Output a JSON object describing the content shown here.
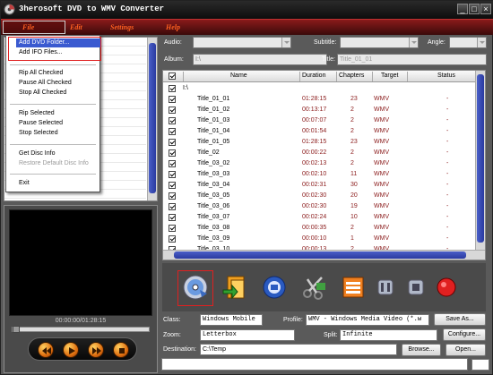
{
  "window": {
    "title": "3herosoft DVD to WMV Converter",
    "controls": [
      "_",
      "□",
      "×"
    ]
  },
  "menubar": {
    "items": [
      "File",
      "Edit",
      "Settings",
      "Help"
    ]
  },
  "file_menu": {
    "group1": [
      "Add DVD Folder...",
      "Add IFO Files..."
    ],
    "group2": [
      "Rip All Checked",
      "Pause All Checked",
      "Stop All Checked"
    ],
    "group3": [
      "Rip Selected",
      "Pause Selected",
      "Stop Selected"
    ],
    "group4": [
      "Get Disc Info",
      "Restore Default Disc Info"
    ],
    "group5": [
      "Exit"
    ]
  },
  "top_controls": {
    "audio_label": "Audio:",
    "subtitle_label": "Subtitle:",
    "angle_label": "Angle:",
    "album_label": "Album:",
    "album_value": "I:\\",
    "title_label": "Title:",
    "title_placeholder": "Title_01_01"
  },
  "file_list": {
    "columns": [
      "Name",
      "Duration",
      "Chapters",
      "Target",
      "Status"
    ],
    "root": "I:\\",
    "rows": [
      {
        "name": "Title_01_01",
        "duration": "01:28:15",
        "chapters": "23",
        "target": "WMV",
        "status": "-"
      },
      {
        "name": "Title_01_02",
        "duration": "00:13:17",
        "chapters": "2",
        "target": "WMV",
        "status": "-"
      },
      {
        "name": "Title_01_03",
        "duration": "00:07:07",
        "chapters": "2",
        "target": "WMV",
        "status": "-"
      },
      {
        "name": "Title_01_04",
        "duration": "00:01:54",
        "chapters": "2",
        "target": "WMV",
        "status": "-"
      },
      {
        "name": "Title_01_05",
        "duration": "01:28:15",
        "chapters": "23",
        "target": "WMV",
        "status": "-"
      },
      {
        "name": "Title_02",
        "duration": "00:00:22",
        "chapters": "2",
        "target": "WMV",
        "status": "-"
      },
      {
        "name": "Title_03_02",
        "duration": "00:02:13",
        "chapters": "2",
        "target": "WMV",
        "status": "-"
      },
      {
        "name": "Title_03_03",
        "duration": "00:02:10",
        "chapters": "11",
        "target": "WMV",
        "status": "-"
      },
      {
        "name": "Title_03_04",
        "duration": "00:02:31",
        "chapters": "30",
        "target": "WMV",
        "status": "-"
      },
      {
        "name": "Title_03_05",
        "duration": "00:02:30",
        "chapters": "20",
        "target": "WMV",
        "status": "-"
      },
      {
        "name": "Title_03_06",
        "duration": "00:02:30",
        "chapters": "19",
        "target": "WMV",
        "status": "-"
      },
      {
        "name": "Title_03_07",
        "duration": "00:02:24",
        "chapters": "10",
        "target": "WMV",
        "status": "-"
      },
      {
        "name": "Title_03_08",
        "duration": "00:00:35",
        "chapters": "2",
        "target": "WMV",
        "status": "-"
      },
      {
        "name": "Title_03_09",
        "duration": "00:00:10",
        "chapters": "1",
        "target": "WMV",
        "status": "-"
      },
      {
        "name": "Title_03_10",
        "duration": "00:00:13",
        "chapters": "2",
        "target": "WMV",
        "status": "-"
      }
    ]
  },
  "preview": {
    "time": "00:00:00/01:28:15"
  },
  "bottom": {
    "class_label": "Class:",
    "class_value": "Windows Mobile",
    "profile_label": "Profile:",
    "profile_value": "WMV - Windows Media Video  (*.w",
    "save_as_label": "Save As...",
    "zoom_label": "Zoom:",
    "zoom_value": "Letterbox",
    "split_label": "Split:",
    "split_value": "Infinite",
    "configure_label": "Configure...",
    "destination_label": "Destination:",
    "destination_value": "C:\\Temp",
    "browse_label": "Browse...",
    "open_label": "Open..."
  },
  "colors": {
    "accent_menu": "#ff6020",
    "highlight_box": "#e02020",
    "list_text_red": "#8a1a1a"
  }
}
